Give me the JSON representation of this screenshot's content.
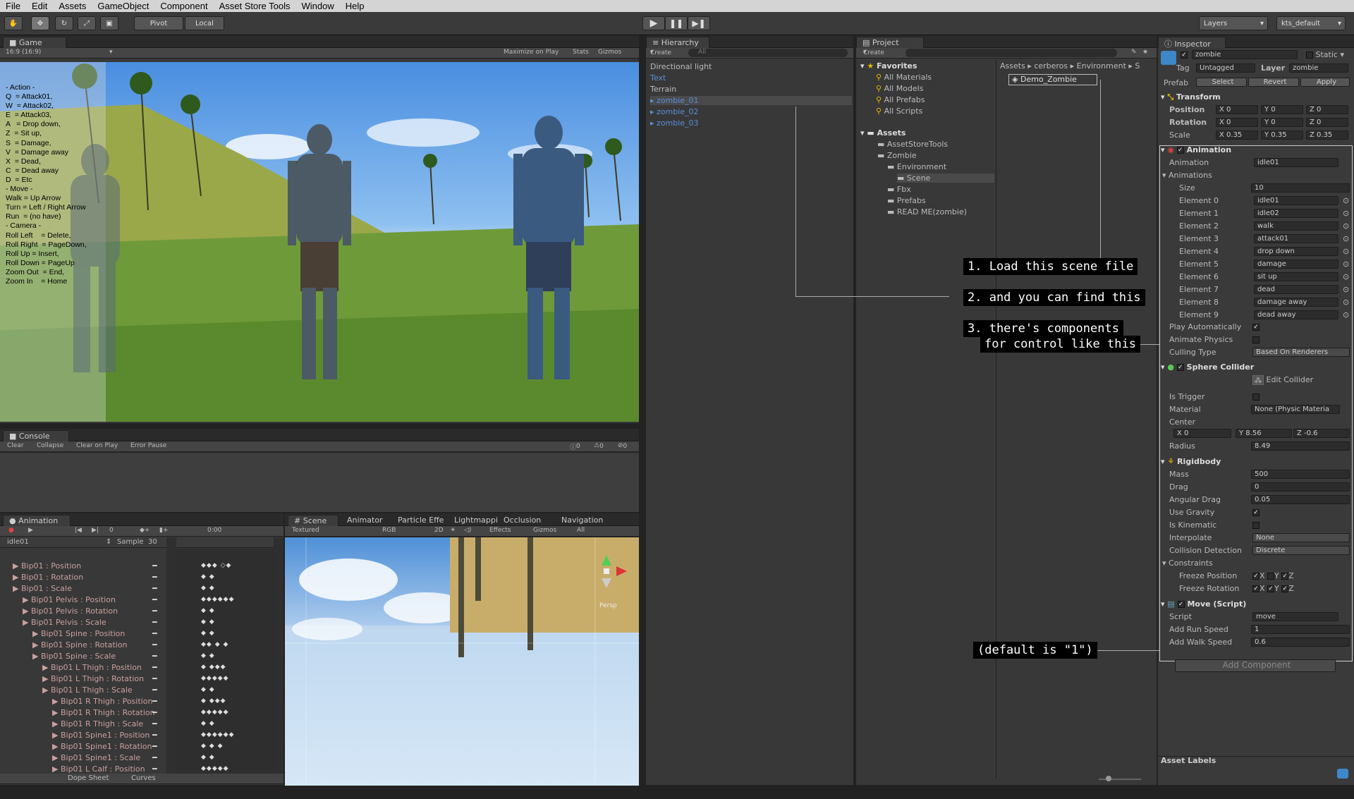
{
  "menu": [
    "File",
    "Edit",
    "Assets",
    "GameObject",
    "Component",
    "Asset Store Tools",
    "Window",
    "Help"
  ],
  "toolbar": {
    "pivot": "Pivot",
    "local": "Local",
    "layers": "Layers",
    "layout": "kts_default"
  },
  "game": {
    "tab": "Game",
    "aspect": "16:9 (16:9)",
    "maximize": "Maximize on Play",
    "stats": "Stats",
    "gizmos": "Gizmos",
    "help_text": [
      "- Action -",
      "",
      "Q  = Attack01,",
      "W  = Attack02,",
      "E  = Attack03,",
      "A   = Drop down,",
      "Z  = Sit up,",
      "S  = Damage,",
      "V  = Damage away",
      "X  = Dead,",
      "C  = Dead away",
      "D  = Etc",
      "",
      "- Move -",
      "",
      "Walk = Up Arrow",
      "Turn = Left / Right Arrow",
      "Run  = (no have)",
      "",
      "",
      "- Camera -",
      "",
      "Roll Left    = Delete,",
      "Roll Right  = PageDown,",
      "Roll Up = Insert,",
      "Roll Down = PageUp",
      "Zoom Out  = End,",
      "Zoom In    = Home"
    ]
  },
  "console": {
    "tab": "Console",
    "buttons": [
      "Clear",
      "Collapse",
      "Clear on Play",
      "Error Pause"
    ],
    "counts": [
      "0",
      "0",
      "0"
    ]
  },
  "animation": {
    "tab": "Animation",
    "frame": "0",
    "time": "0:00",
    "clip": "idle01",
    "sample_label": "Sample",
    "sample": "30",
    "rows": [
      {
        "t": "Bip01 : Position",
        "k": "◆◆◆ ◇◆"
      },
      {
        "t": "Bip01 : Rotation",
        "k": "◆      ◆"
      },
      {
        "t": "Bip01 : Scale",
        "k": "◆      ◆"
      },
      {
        "t": "Bip01 Pelvis : Position",
        "k": "◆◆◆◆◆◆"
      },
      {
        "t": "Bip01 Pelvis : Rotation",
        "k": "◆      ◆"
      },
      {
        "t": "Bip01 Pelvis : Scale",
        "k": "◆      ◆"
      },
      {
        "t": "Bip01 Spine : Position",
        "k": "◆      ◆"
      },
      {
        "t": "Bip01 Spine : Rotation",
        "k": "◆◆ ◆ ◆"
      },
      {
        "t": "Bip01 Spine : Scale",
        "k": "◆      ◆"
      },
      {
        "t": "Bip01 L Thigh : Position",
        "k": "◆ ◆◆◆"
      },
      {
        "t": "Bip01 L Thigh : Rotation",
        "k": "◆◆◆◆◆"
      },
      {
        "t": "Bip01 L Thigh : Scale",
        "k": "◆      ◆"
      },
      {
        "t": "Bip01 R Thigh : Position",
        "k": "◆ ◆◆◆"
      },
      {
        "t": "Bip01 R Thigh : Rotation",
        "k": "◆◆◆◆◆"
      },
      {
        "t": "Bip01 R Thigh : Scale",
        "k": "◆      ◆"
      },
      {
        "t": "Bip01 Spine1 : Position",
        "k": "◆◆◆◆◆◆"
      },
      {
        "t": "Bip01 Spine1 : Rotation",
        "k": "◆  ◆  ◆"
      },
      {
        "t": "Bip01 Spine1 : Scale",
        "k": "◆      ◆"
      },
      {
        "t": "Bip01 L Calf : Position",
        "k": "◆◆◆◆◆"
      }
    ],
    "bottom": [
      "Dope Sheet",
      "Curves"
    ]
  },
  "scene": {
    "tabs": [
      "Scene",
      "Animator",
      "Particle Effe",
      "Lightmappi",
      "Occlusion",
      "Navigation"
    ],
    "mode": "Textured",
    "rgb": "RGB",
    "twod": "2D",
    "effects": "Effects",
    "gizmos": "Gizmos",
    "search": "All",
    "persp": "Persp"
  },
  "hierarchy": {
    "tab": "Hierarchy",
    "create": "Create",
    "search": "All",
    "items": [
      {
        "t": "Directional light",
        "c": "#bbb"
      },
      {
        "t": "Text",
        "c": "#5b8fd9"
      },
      {
        "t": "Terrain",
        "c": "#bbb"
      },
      {
        "t": "zombie_01",
        "c": "#5b8fd9"
      },
      {
        "t": "zombie_02",
        "c": "#5b8fd9"
      },
      {
        "t": "zombie_03",
        "c": "#5b8fd9"
      }
    ]
  },
  "project": {
    "tab": "Project",
    "create": "Create",
    "favorites": "Favorites",
    "fav_items": [
      "All Materials",
      "All Models",
      "All Prefabs",
      "All Scripts"
    ],
    "assets": "Assets",
    "tree": [
      {
        "t": "AssetStoreTools",
        "d": 1
      },
      {
        "t": "Zombie",
        "d": 1
      },
      {
        "t": "Environment",
        "d": 2
      },
      {
        "t": "Scene",
        "d": 3
      },
      {
        "t": "Fbx",
        "d": 2
      },
      {
        "t": "Prefabs",
        "d": 2
      },
      {
        "t": "READ ME(zombie)",
        "d": 2
      }
    ],
    "breadcrumb": "Assets ▸ cerberos ▸ Environment ▸ S",
    "file": "Demo_Zombie"
  },
  "inspector": {
    "tab": "Inspector",
    "name": "zombie",
    "static": "Static",
    "tag_label": "Tag",
    "tag": "Untagged",
    "layer_label": "Layer",
    "layer": "zombie",
    "prefab_label": "Prefab",
    "prefab_btns": [
      "Select",
      "Revert",
      "Apply"
    ],
    "transform": {
      "title": "Transform",
      "position": "Position",
      "rotation": "Rotation",
      "scale": "Scale",
      "pos": [
        "X 0",
        "Y 0",
        "Z 0"
      ],
      "rot": [
        "X 0",
        "Y 0",
        "Z 0"
      ],
      "scl": [
        "X 0.35",
        "Y 0.35",
        "Z 0.35"
      ]
    },
    "animation": {
      "title": "Animation",
      "anim_label": "Animation",
      "anim_val": "idle01",
      "anims_label": "Animations",
      "size_label": "Size",
      "size": "10",
      "elements": [
        {
          "l": "Element 0",
          "v": "idle01"
        },
        {
          "l": "Element 1",
          "v": "idle02"
        },
        {
          "l": "Element 2",
          "v": "walk"
        },
        {
          "l": "Element 3",
          "v": "attack01"
        },
        {
          "l": "Element 4",
          "v": "drop down"
        },
        {
          "l": "Element 5",
          "v": "damage"
        },
        {
          "l": "Element 6",
          "v": "sit up"
        },
        {
          "l": "Element 7",
          "v": "dead"
        },
        {
          "l": "Element 8",
          "v": "damage away"
        },
        {
          "l": "Element 9",
          "v": "dead away"
        }
      ],
      "play": "Play Automatically",
      "physics": "Animate Physics",
      "culling": "Culling Type",
      "culling_val": "Based On Renderers"
    },
    "sphere": {
      "title": "Sphere Collider",
      "edit": "Edit Collider",
      "trigger": "Is Trigger",
      "material": "Material",
      "material_val": "None (Physic Materia",
      "center": "Center",
      "cx": "X 0",
      "cy": "Y 8.56",
      "cz": "Z -0.6",
      "radius": "Radius",
      "radius_val": "8.49"
    },
    "rigidbody": {
      "title": "Rigidbody",
      "rows": [
        {
          "l": "Mass",
          "v": "500"
        },
        {
          "l": "Drag",
          "v": "0"
        },
        {
          "l": "Angular Drag",
          "v": "0.05"
        }
      ],
      "gravity": "Use Gravity",
      "kinematic": "Is Kinematic",
      "interp": "Interpolate",
      "interp_val": "None",
      "collision": "Collision Detection",
      "collision_val": "Discrete",
      "constraints": "Constraints",
      "fpos": "Freeze Position",
      "frot": "Freeze Rotation",
      "x": "X",
      "y": "Y",
      "z": "Z"
    },
    "move": {
      "title": "Move (Script)",
      "script": "Script",
      "script_val": "move",
      "run": "Add Run Speed",
      "run_val": "1",
      "walk": "Add Walk Speed",
      "walk_val": "0.6"
    },
    "add": "Add Component",
    "labels": "Asset Labels"
  },
  "callouts": [
    "1. Load this scene file",
    "2. and you can find this",
    "3. there's components",
    "for control like this",
    "(default is \"1\")"
  ]
}
